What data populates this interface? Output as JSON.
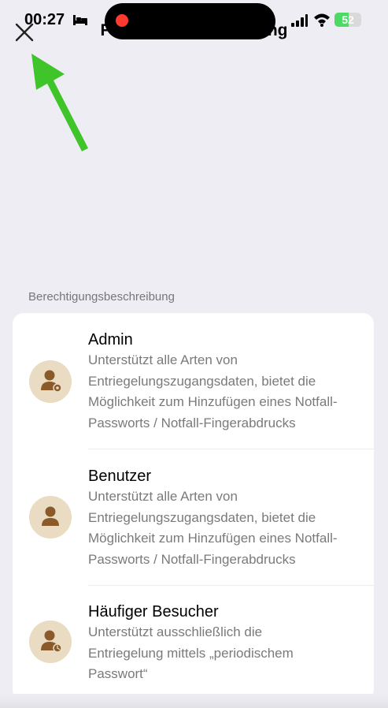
{
  "status_bar": {
    "time": "00:27",
    "battery_level": "52",
    "battery_percent": 52,
    "recording_color": "#ff3b30",
    "icons": [
      "bed-icon",
      "signal-icon",
      "wifi-icon",
      "battery-icon"
    ]
  },
  "header": {
    "title": "Funktionsbeschreibung",
    "close_icon": "close-icon"
  },
  "annotation": {
    "arrow_color": "#3fc42a",
    "icon": "arrow-up-left-icon"
  },
  "section_label": "Berechtigungsbeschreibung",
  "roles": [
    {
      "title": "Admin",
      "icon": "admin-user-icon",
      "desc_lines": [
        "Unterstützt alle Arten von",
        "Entriegelungszugangsdaten, bietet die",
        "Möglichkeit zum Hinzufügen eines Notfall-",
        "Passworts / Notfall-Fingerabdrucks"
      ]
    },
    {
      "title": "Benutzer",
      "icon": "user-icon",
      "desc_lines": [
        "Unterstützt alle Arten von",
        "Entriegelungszugangsdaten, bietet die",
        "Möglichkeit zum Hinzufügen eines Notfall-",
        "Passworts / Notfall-Fingerabdrucks"
      ]
    },
    {
      "title": "Häufiger Besucher",
      "icon": "frequent-visitor-icon",
      "desc_lines": [
        "Unterstützt ausschließlich die",
        "Entriegelung mittels „periodischem",
        "Passwort“"
      ]
    }
  ],
  "colors": {
    "background": "#eeedf3",
    "avatar_bg": "#e9dcc2",
    "avatar_fg": "#8b5a2b",
    "desc_text": "#7a7a7a"
  }
}
